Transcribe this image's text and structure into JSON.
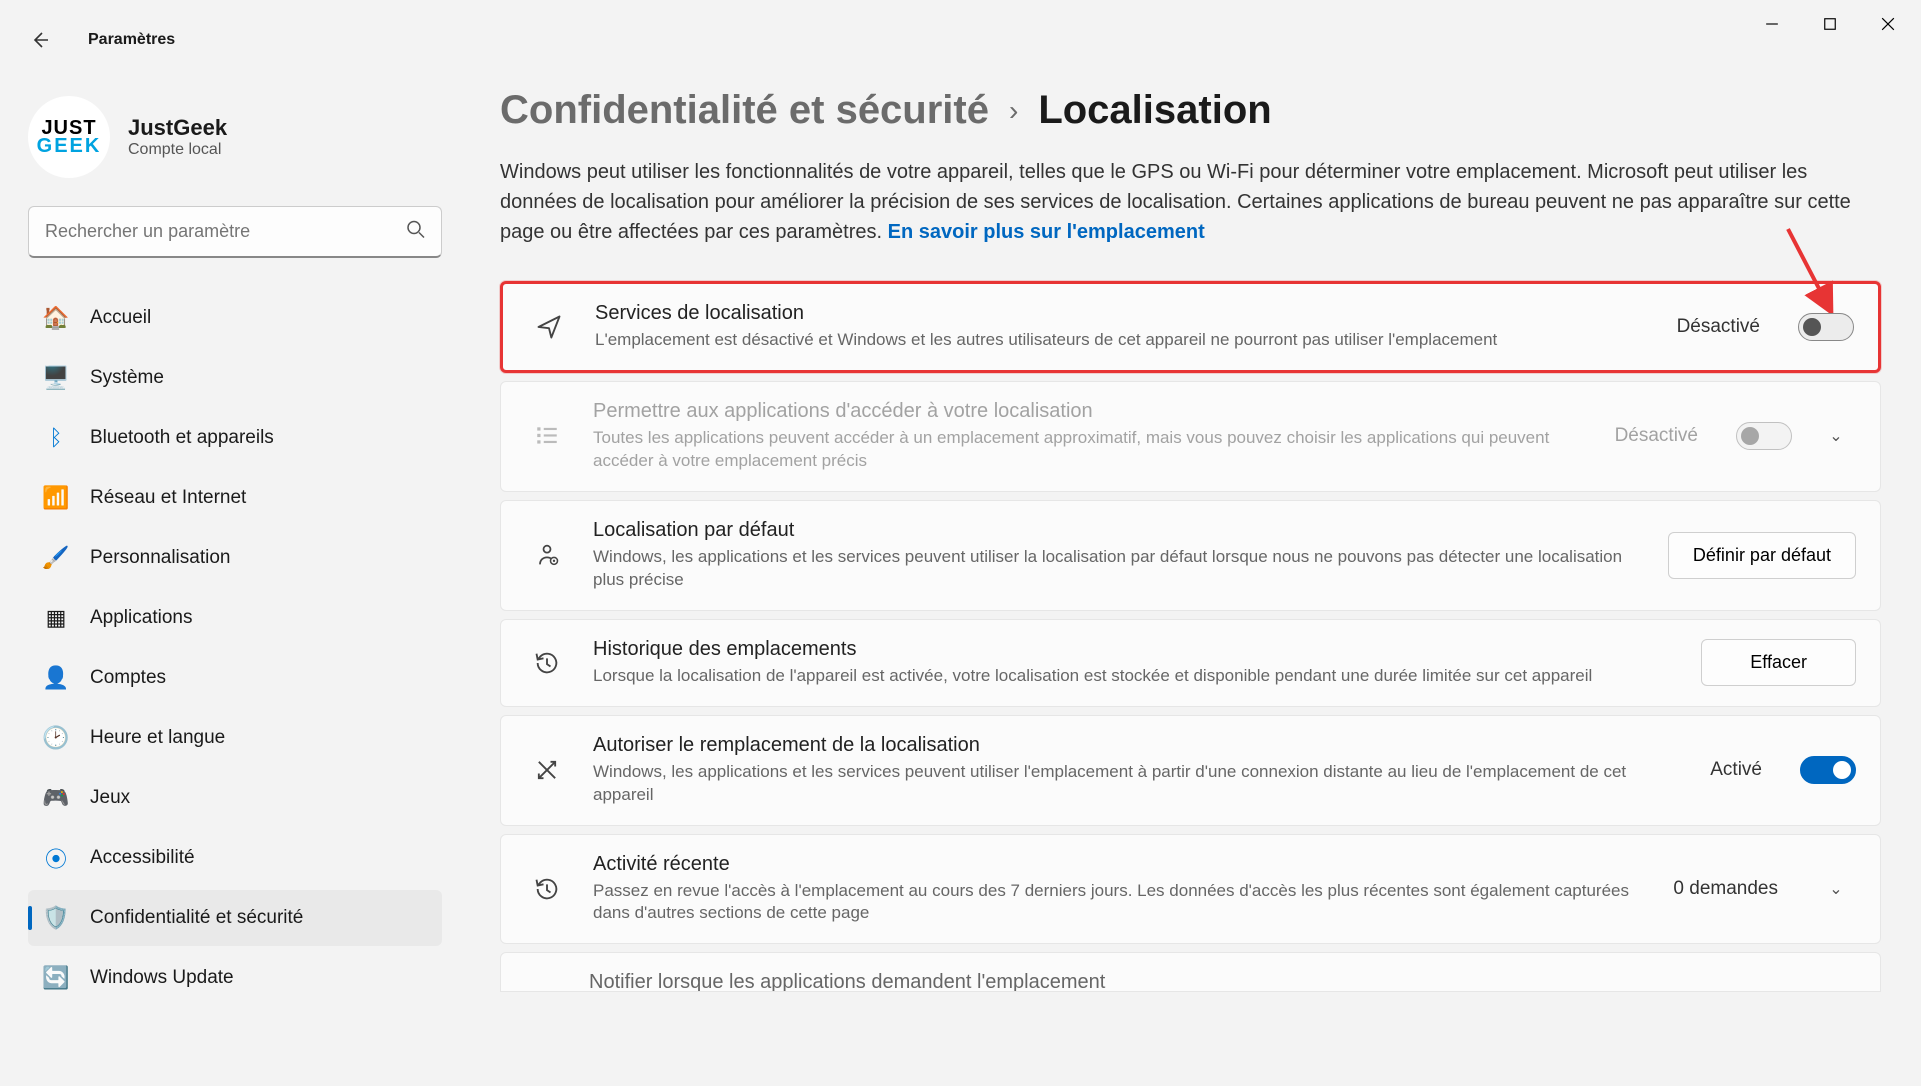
{
  "app_title": "Paramètres",
  "user": {
    "name": "JustGeek",
    "sub": "Compte local",
    "logo_top": "JUST",
    "logo_bottom": "GEEK"
  },
  "search": {
    "placeholder": "Rechercher un paramètre"
  },
  "sidebar": {
    "items": [
      {
        "label": "Accueil",
        "icon": "home"
      },
      {
        "label": "Système",
        "icon": "system"
      },
      {
        "label": "Bluetooth et appareils",
        "icon": "bluetooth"
      },
      {
        "label": "Réseau et Internet",
        "icon": "network"
      },
      {
        "label": "Personnalisation",
        "icon": "personalization"
      },
      {
        "label": "Applications",
        "icon": "apps"
      },
      {
        "label": "Comptes",
        "icon": "accounts"
      },
      {
        "label": "Heure et langue",
        "icon": "time"
      },
      {
        "label": "Jeux",
        "icon": "gaming"
      },
      {
        "label": "Accessibilité",
        "icon": "accessibility"
      },
      {
        "label": "Confidentialité et sécurité",
        "icon": "privacy",
        "active": true
      },
      {
        "label": "Windows Update",
        "icon": "update"
      }
    ]
  },
  "breadcrumb": {
    "root": "Confidentialité et sécurité",
    "leaf": "Localisation"
  },
  "intro": {
    "text": "Windows peut utiliser les fonctionnalités de votre appareil, telles que le GPS ou Wi-Fi pour déterminer votre emplacement. Microsoft peut utiliser les données de localisation pour améliorer la précision de ses services de localisation. Certaines applications de bureau peuvent ne pas apparaître sur cette page ou être affectées par ces paramètres.  ",
    "link": "En savoir plus sur l'emplacement"
  },
  "cards": {
    "loc_services": {
      "title": "Services de localisation",
      "desc": "L'emplacement est désactivé et Windows et les autres utilisateurs de cet appareil ne pourront pas utiliser l'emplacement",
      "state": "Désactivé",
      "on": false
    },
    "app_access": {
      "title": "Permettre aux applications d'accéder à votre localisation",
      "desc": "Toutes les applications peuvent accéder à un emplacement approximatif, mais vous pouvez choisir les applications qui peuvent accéder à votre emplacement précis",
      "state": "Désactivé",
      "on": false
    },
    "default_loc": {
      "title": "Localisation par défaut",
      "desc": "Windows, les applications et les services peuvent utiliser la localisation par défaut lorsque nous ne pouvons pas détecter une localisation plus précise",
      "button": "Définir par défaut"
    },
    "history": {
      "title": "Historique des emplacements",
      "desc": "Lorsque la localisation de l'appareil est activée, votre localisation est stockée et disponible pendant une durée limitée sur cet appareil",
      "button": "Effacer"
    },
    "override": {
      "title": "Autoriser le remplacement de la localisation",
      "desc": "Windows, les applications et les services peuvent utiliser l'emplacement à partir d'une connexion distante au lieu de l'emplacement de cet appareil",
      "state": "Activé",
      "on": true
    },
    "recent": {
      "title": "Activité récente",
      "desc": "Passez en revue l'accès à l'emplacement au cours des 7 derniers jours. Les données d'accès les plus récentes sont également capturées dans d'autres sections de cette page",
      "count": "0 demandes"
    },
    "notify": {
      "title": "Notifier lorsque les applications demandent l'emplacement"
    }
  }
}
